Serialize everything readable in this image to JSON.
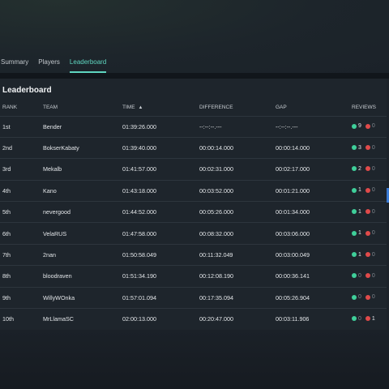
{
  "tabs": [
    {
      "label": "Summary",
      "active": false
    },
    {
      "label": "Players",
      "active": false
    },
    {
      "label": "Leaderboard",
      "active": true
    }
  ],
  "panel_title": "Leaderboard",
  "columns": {
    "rank": "RANK",
    "team": "TEAM",
    "time": "TIME",
    "difference": "DIFFERENCE",
    "gap": "GAP",
    "reviews": "REVIEWS"
  },
  "rows": [
    {
      "rank": "1st",
      "team": "Bender",
      "time": "01:39:26.000",
      "difference": "--:--:--.---",
      "gap": "--:--:--.---",
      "up": "9",
      "down": "0"
    },
    {
      "rank": "2nd",
      "team": "BokserKabaty",
      "time": "01:39:40.000",
      "difference": "00:00:14.000",
      "gap": "00:00:14.000",
      "up": "3",
      "down": "0"
    },
    {
      "rank": "3rd",
      "team": "Mekalb",
      "time": "01:41:57.000",
      "difference": "00:02:31.000",
      "gap": "00:02:17.000",
      "up": "2",
      "down": "0"
    },
    {
      "rank": "4th",
      "team": "Kano",
      "time": "01:43:18.000",
      "difference": "00:03:52.000",
      "gap": "00:01:21.000",
      "up": "1",
      "down": "0"
    },
    {
      "rank": "5th",
      "team": "nevergood",
      "time": "01:44:52.000",
      "difference": "00:05:26.000",
      "gap": "00:01:34.000",
      "up": "1",
      "down": "0"
    },
    {
      "rank": "6th",
      "team": "VelaRUS",
      "time": "01:47:58.000",
      "difference": "00:08:32.000",
      "gap": "00:03:06.000",
      "up": "1",
      "down": "0"
    },
    {
      "rank": "7th",
      "team": "2nan",
      "time": "01:50:58.049",
      "difference": "00:11:32.049",
      "gap": "00:03:00.049",
      "up": "1",
      "down": "0"
    },
    {
      "rank": "8th",
      "team": "bloodraven",
      "time": "01:51:34.190",
      "difference": "00:12:08.190",
      "gap": "00:00:36.141",
      "up": "0",
      "down": "0"
    },
    {
      "rank": "9th",
      "team": "WillyWOnka",
      "time": "01:57:01.094",
      "difference": "00:17:35.094",
      "gap": "00:05:26.904",
      "up": "0",
      "down": "0"
    },
    {
      "rank": "10th",
      "team": "MrLlamaSC",
      "time": "02:00:13.000",
      "difference": "00:20:47.000",
      "gap": "00:03:11.906",
      "up": "0",
      "down": "1"
    }
  ],
  "colors": {
    "accent": "#5fd6c0",
    "positive": "#3fcf9a",
    "negative": "#e04a4a"
  },
  "icons": {
    "sort": "sort-ascending-icon",
    "up": "thumbs-up-dot-icon",
    "down": "thumbs-down-dot-icon"
  }
}
